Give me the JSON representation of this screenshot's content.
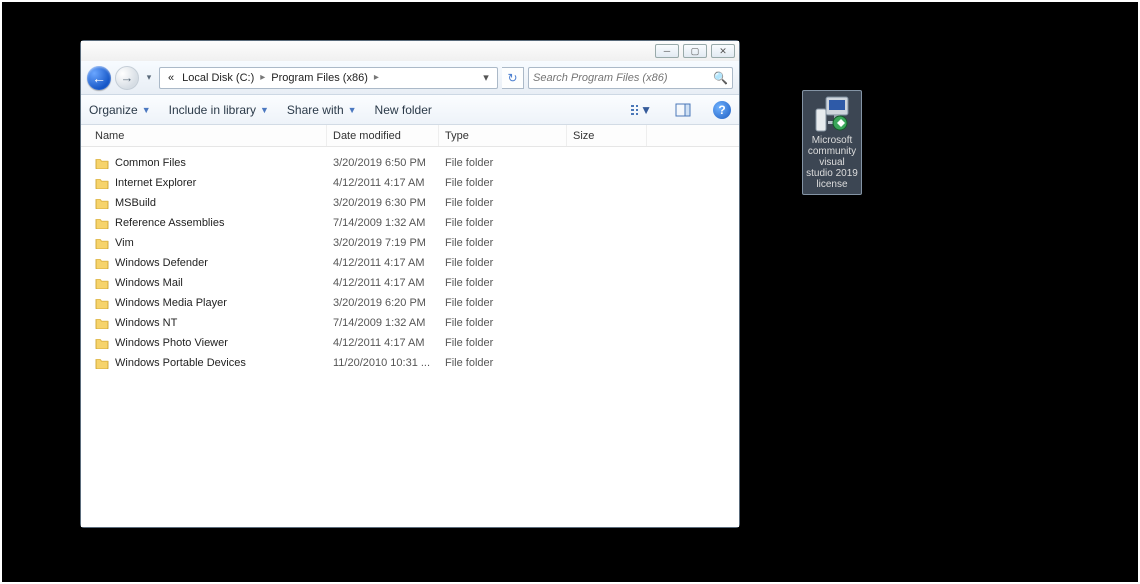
{
  "window": {
    "minimize_tip": "Minimize",
    "maximize_tip": "Maximize",
    "close_tip": "Close"
  },
  "breadcrumb": {
    "prefix": "«",
    "parts": [
      "Local Disk (C:)",
      "Program Files (x86)"
    ]
  },
  "search": {
    "placeholder": "Search Program Files (x86)"
  },
  "toolbar": {
    "organize": "Organize",
    "include": "Include in library",
    "share": "Share with",
    "newfolder": "New folder"
  },
  "columns": {
    "name": "Name",
    "date": "Date modified",
    "type": "Type",
    "size": "Size"
  },
  "rows": [
    {
      "name": "Common Files",
      "date": "3/20/2019 6:50 PM",
      "type": "File folder"
    },
    {
      "name": "Internet Explorer",
      "date": "4/12/2011 4:17 AM",
      "type": "File folder"
    },
    {
      "name": "MSBuild",
      "date": "3/20/2019 6:30 PM",
      "type": "File folder"
    },
    {
      "name": "Reference Assemblies",
      "date": "7/14/2009 1:32 AM",
      "type": "File folder"
    },
    {
      "name": "Vim",
      "date": "3/20/2019 7:19 PM",
      "type": "File folder"
    },
    {
      "name": "Windows Defender",
      "date": "4/12/2011 4:17 AM",
      "type": "File folder"
    },
    {
      "name": "Windows Mail",
      "date": "4/12/2011 4:17 AM",
      "type": "File folder"
    },
    {
      "name": "Windows Media Player",
      "date": "3/20/2019 6:20 PM",
      "type": "File folder"
    },
    {
      "name": "Windows NT",
      "date": "7/14/2009 1:32 AM",
      "type": "File folder"
    },
    {
      "name": "Windows Photo Viewer",
      "date": "4/12/2011 4:17 AM",
      "type": "File folder"
    },
    {
      "name": "Windows Portable Devices",
      "date": "11/20/2010 10:31 ...",
      "type": "File folder"
    }
  ],
  "desktop_icon": {
    "label": "Microsoft community visual studio 2019 license"
  }
}
